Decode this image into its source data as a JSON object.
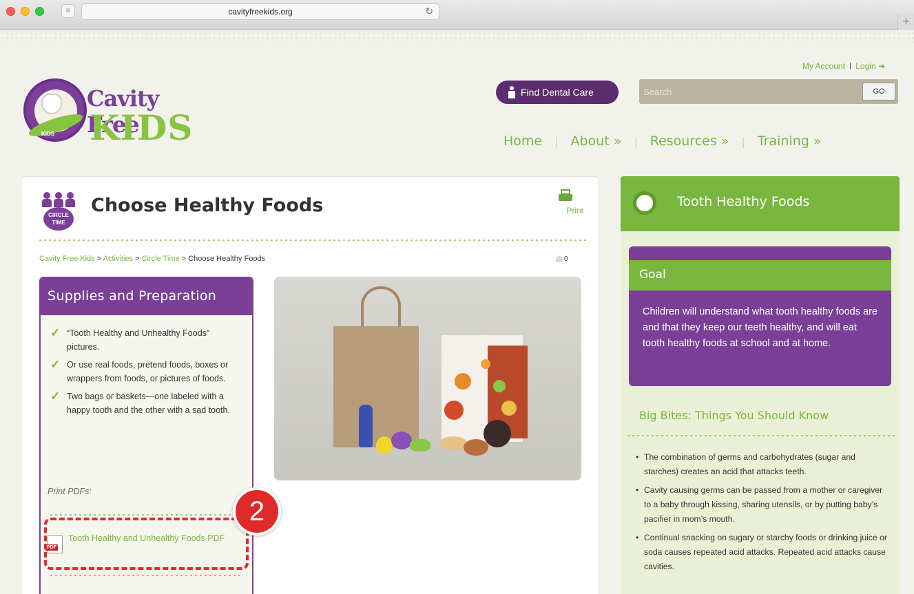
{
  "browser": {
    "url": "cavityfreekids.org"
  },
  "header": {
    "my_account": "My Account",
    "login": "Login ➜",
    "logo_word1": "Cavity Free",
    "logo_word2": "KIDS",
    "logo_ring_text": "Cavity Free",
    "logo_ring_bottom": "KIDS",
    "find_dental_care": "Find Dental Care",
    "search_placeholder": "Search",
    "go_label": "GO",
    "nav": [
      {
        "label": "Home"
      },
      {
        "label": "About »"
      },
      {
        "label": "Resources »"
      },
      {
        "label": "Training »"
      }
    ]
  },
  "main": {
    "title": "Choose Healthy Foods",
    "category_badge": "CIRCLE TIME",
    "print_label": "Print",
    "breadcrumb": {
      "crumb1": "Cavity Free Kids",
      "crumb2": "Activities",
      "crumb3": "Circle Time",
      "current": "Choose Healthy Foods",
      "separator": " > "
    },
    "likes_count": "0",
    "supplies": {
      "heading": "Supplies and Preparation",
      "items": [
        "“Tooth Healthy and Unhealthy Foods” pictures.",
        "Or use real foods, pretend foods, boxes or wrappers from foods, or pictures of foods.",
        "Two bags or baskets—one labeled with a happy tooth and the other with a sad tooth."
      ],
      "print_pdfs_label": "Print PDFs:",
      "pdf_link": "Tooth Healthy and Unhealthy Foods PDF"
    }
  },
  "sidebar": {
    "title": "Tooth Healthy Foods",
    "goal_heading": "Goal",
    "goal_text": "Children will understand what tooth healthy foods are and that they keep our teeth healthy, and will eat tooth healthy foods at school and at home.",
    "big_bites_heading": "Big Bites: Things You Should Know",
    "bites": [
      "The combination of germs and carbohydrates (sugar and starches) creates an acid that attacks teeth.",
      "Cavity causing germs can be passed from a mother or caregiver to a baby through kissing, sharing utensils, or by putting baby’s pacifier in mom’s mouth.",
      "Continual snacking on sugary or starchy foods or drinking juice or soda causes repeated acid attacks. Repeated acid attacks cause cavities."
    ]
  },
  "annotation": {
    "step_number": "2"
  },
  "colors": {
    "brand_purple": "#7b3f98",
    "brand_green": "#79b63f",
    "callout_red": "#e02a2a"
  }
}
